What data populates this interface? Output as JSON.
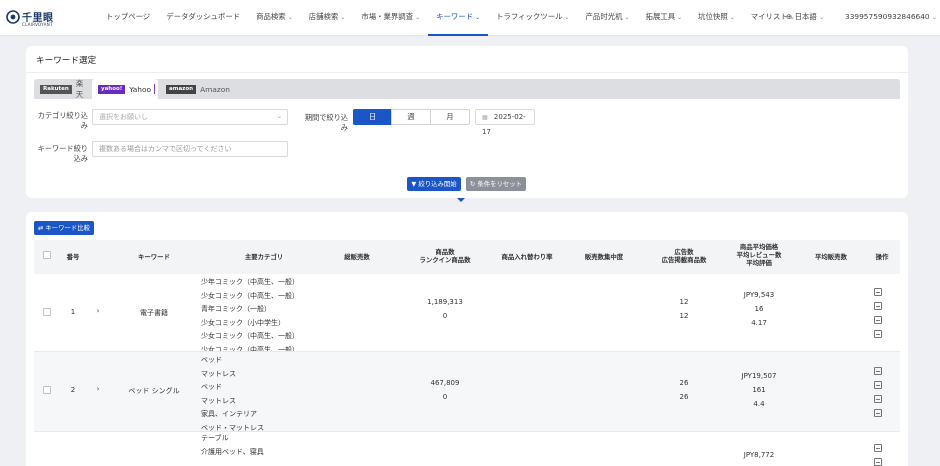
{
  "brand": {
    "name": "千里眼",
    "sub": "CLAIRVOYANT"
  },
  "nav": {
    "items": [
      {
        "label": "トップページ",
        "chevron": false,
        "active": false
      },
      {
        "label": "データダッシュボード",
        "chevron": false,
        "active": false
      },
      {
        "label": "商品検索",
        "chevron": true,
        "active": false
      },
      {
        "label": "店舗検索",
        "chevron": true,
        "active": false
      },
      {
        "label": "市場・業界調査",
        "chevron": true,
        "active": false
      },
      {
        "label": "キーワード",
        "chevron": true,
        "active": true
      },
      {
        "label": "トラフィックツール",
        "chevron": true,
        "active": false
      },
      {
        "label": "产品时光机",
        "chevron": true,
        "active": false
      },
      {
        "label": "拓展工具",
        "chevron": true,
        "active": false
      },
      {
        "label": "坑位快照",
        "chevron": true,
        "active": false
      },
      {
        "label": "マイリスト",
        "chevron": true,
        "active": false
      }
    ],
    "language": "日本語",
    "account": "33995759093284664​0"
  },
  "filter": {
    "title": "キーワード選定",
    "tabs": [
      {
        "label": "楽天",
        "logo": "Rakuten"
      },
      {
        "label": "Yahoo",
        "logo": "yahoo!"
      },
      {
        "label": "Amazon",
        "logo": "amazon"
      }
    ],
    "category_label": "カテゴリ絞り込み",
    "category_placeholder": "選択をお願いし",
    "keyword_label": "キーワード絞り込み",
    "keyword_placeholder": "複数ある場合はカンマで区切ってください",
    "period_label": "期間で絞り込み",
    "period_options": [
      "日",
      "週",
      "月"
    ],
    "period_selected": "日",
    "date": "2025-02-17",
    "search_button": "絞り込み開始",
    "reset_button": "条件をリセット"
  },
  "table": {
    "compare_button": "キーワード比較",
    "headers": {
      "no": "番号",
      "keyword": "キーワード",
      "category": "主要カテゴリ",
      "sales": "総販売数",
      "items": [
        "商品数",
        "ランクイン商品数"
      ],
      "turnover": "商品入れ替わり率",
      "concentration": "販売数集中度",
      "ads": [
        "広告数",
        "広告掲載商品数"
      ],
      "price": [
        "商品平均価格",
        "平均レビュー数",
        "平均評価"
      ],
      "avg_sales": "平均販売数",
      "ops": "操作"
    },
    "rows": [
      {
        "no": "1",
        "keyword": "電子書籍",
        "categories": [
          "少年コミック（中高生、一般）",
          "少女コミック（中高生、一般）",
          "青年コミック（一般）",
          "少女コミック（小中学生）",
          "少女コミック（中高生、一般）",
          "少女コミック（中高生、一般）"
        ],
        "items": "1,189,313",
        "ranked": "0",
        "ads": "12",
        "ad_items": "12",
        "price": "JPY9,543",
        "reviews": "16",
        "rating": "4.17"
      },
      {
        "no": "2",
        "keyword": "ベッド シングル",
        "categories": [
          "ベッド",
          "マットレス",
          "ベッド",
          "マットレス",
          "家具、インテリア",
          "ベッド・マットレス"
        ],
        "items": "467,809",
        "ranked": "0",
        "ads": "26",
        "ad_items": "26",
        "price": "JPY19,507",
        "reviews": "161",
        "rating": "4.4"
      },
      {
        "categories": [
          "テーブル",
          "介護用ベッド、寝具"
        ],
        "price": "JPY8,772"
      }
    ]
  },
  "colors": {
    "accent": "#1a56c8",
    "brand": "#1d3a6b"
  }
}
